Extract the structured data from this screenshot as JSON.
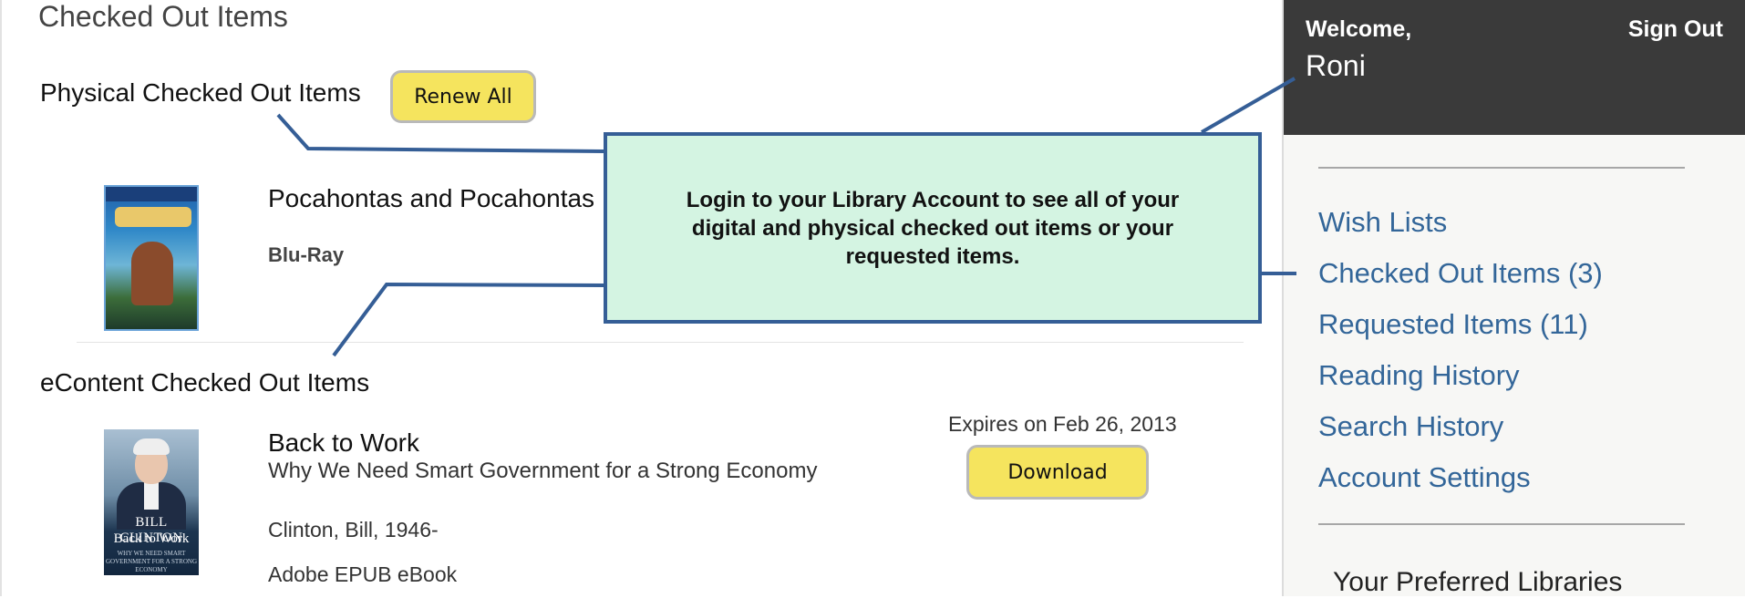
{
  "main": {
    "page_title": "Checked Out Items",
    "physical_heading": "Physical Checked Out Items",
    "renew_all_label": "Renew All",
    "physical_items": [
      {
        "title": "Pocahontas and Pocahontas",
        "format": "Blu-Ray"
      }
    ],
    "econtent_heading": "eContent Checked Out Items",
    "econtent_items": [
      {
        "title": "Back to Work",
        "subtitle": "Why We Need Smart Government for a Strong Economy",
        "author": "Clinton, Bill, 1946-",
        "format": "Adobe EPUB eBook",
        "expires": "Expires on Feb 26, 2013",
        "download_label": "Download",
        "cover_author": "BILL CLINTON",
        "cover_title": "Back to Work",
        "cover_subtitle": "WHY WE NEED SMART GOVERNMENT FOR A STRONG ECONOMY"
      }
    ]
  },
  "sidebar": {
    "welcome_label": "Welcome,",
    "username": "Roni",
    "sign_out_label": "Sign Out",
    "links": [
      {
        "label": "Wish Lists"
      },
      {
        "label": "Checked Out Items (3)"
      },
      {
        "label": "Requested Items (11)"
      },
      {
        "label": "Reading History"
      },
      {
        "label": "Search History"
      },
      {
        "label": "Account Settings"
      }
    ],
    "preferred_libraries_heading": "Your Preferred Libraries"
  },
  "callout": {
    "text": "Login to your Library Account to see all of your digital and physical checked out items or your requested items."
  },
  "colors": {
    "accent_link": "#336699",
    "button_yellow": "#f5e45e",
    "callout_fill": "#d4f4e2",
    "callout_border": "#355e96",
    "header_dark": "#3a3a3a"
  }
}
